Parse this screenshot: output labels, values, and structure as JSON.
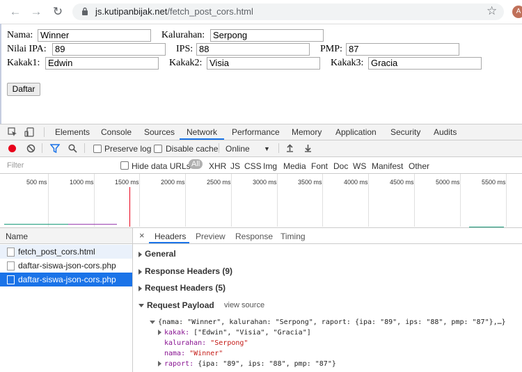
{
  "browser": {
    "url_host": "js.kutipanbijak.net",
    "url_path": "/fetch_post_cors.html",
    "avatar_letter": "A",
    "back_icon": "arrow-left-icon",
    "forward_icon": "arrow-right-icon",
    "reload_icon": "reload-icon",
    "star_icon": "star-icon"
  },
  "form": {
    "nama_label": "Nama:",
    "nama_value": "Winner",
    "kalurahan_label": "Kalurahan:",
    "kalurahan_value": "Serpong",
    "ipa_label": "Nilai IPA:",
    "ipa_value": "89",
    "ips_label": "IPS:",
    "ips_value": "88",
    "pmp_label": "PMP:",
    "pmp_value": "87",
    "kakak1_label": "Kakak1:",
    "kakak1_value": "Edwin",
    "kakak2_label": "Kakak2:",
    "kakak2_value": "Visia",
    "kakak3_label": "Kakak3:",
    "kakak3_value": "Gracia",
    "submit_label": "Daftar"
  },
  "devtools": {
    "tabs": [
      "Elements",
      "Console",
      "Sources",
      "Network",
      "Performance",
      "Memory",
      "Application",
      "Security",
      "Audits"
    ],
    "active_tab": "Network",
    "preserve_log": "Preserve log",
    "disable_cache": "Disable cache",
    "throttle": "Online",
    "filter_placeholder": "Filter",
    "hide_data_urls": "Hide data URLs",
    "filter_types": [
      "All",
      "XHR",
      "JS",
      "CSS",
      "Img",
      "Media",
      "Font",
      "Doc",
      "WS",
      "Manifest",
      "Other"
    ],
    "timeline_ticks": [
      "500 ms",
      "1000 ms",
      "1500 ms",
      "2000 ms",
      "2500 ms",
      "3000 ms",
      "3500 ms",
      "4000 ms",
      "4500 ms",
      "5000 ms",
      "5500 ms"
    ],
    "name_header": "Name",
    "requests": [
      "fetch_post_cors.html",
      "daftar-siswa-json-cors.php",
      "daftar-siswa-json-cors.php"
    ],
    "selected_request": 2,
    "detail_close": "×",
    "detail_tabs": [
      "Headers",
      "Preview",
      "Response",
      "Timing"
    ],
    "active_detail_tab": "Headers",
    "sections": {
      "general": "General",
      "response_headers": "Response Headers (9)",
      "request_headers": "Request Headers (5)",
      "request_payload": "Request Payload",
      "view_source": "view source"
    },
    "payload": {
      "summary": "{nama: \"Winner\", kalurahan: \"Serpong\", raport: {ipa: \"89\", ips: \"88\", pmp: \"87\"},…}",
      "kakak_key": "kakak:",
      "kakak_val": "[\"Edwin\", \"Visia\", \"Gracia\"]",
      "kalurahan_key": "kalurahan:",
      "kalurahan_val": "\"Serpong\"",
      "nama_key": "nama:",
      "nama_val": "\"Winner\"",
      "raport_key": "raport:",
      "raport_val": "{ipa: \"89\", ips: \"88\", pmp: \"87\"}"
    },
    "colors": {
      "accent": "#1a73e8",
      "record": "#e8001a",
      "selected_row": "#1a73e8"
    }
  }
}
